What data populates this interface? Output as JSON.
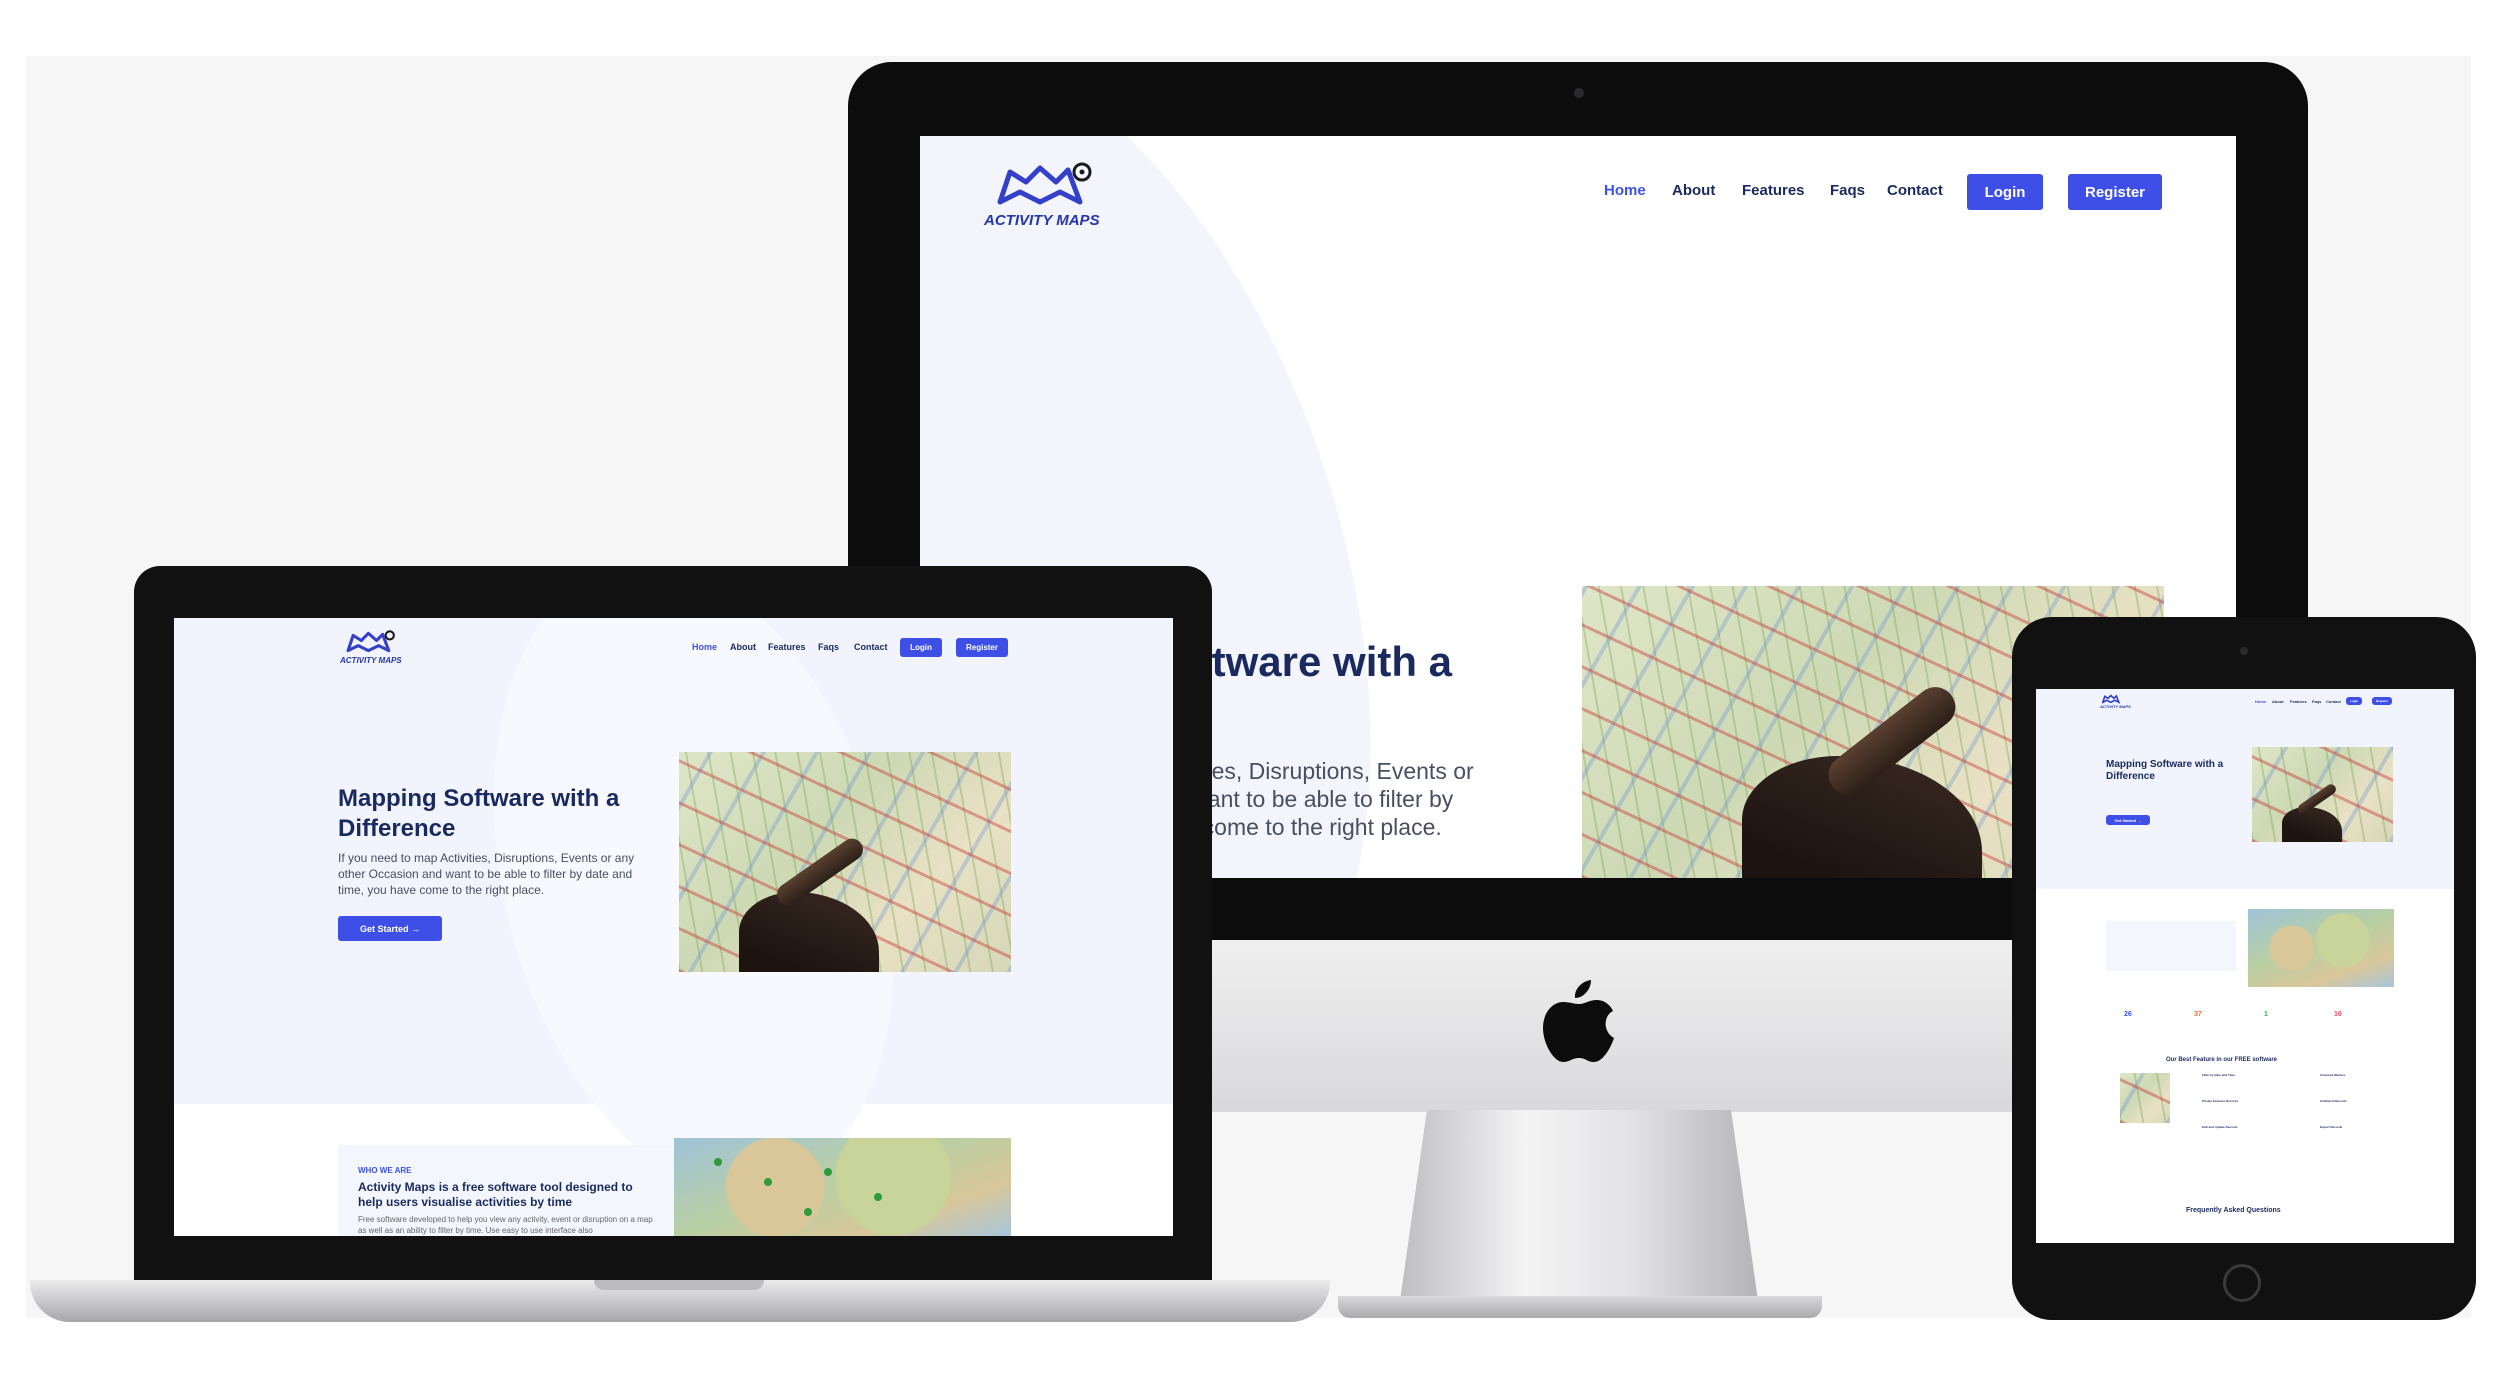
{
  "site": {
    "logo_text": "ACTIVITY MAPS",
    "nav": {
      "home": "Home",
      "about": "About",
      "features": "Features",
      "faqs": "Faqs",
      "contact": "Contact",
      "login": "Login",
      "register": "Register"
    },
    "colors": {
      "accent": "#3d4fe6",
      "navy": "#1b2a5e",
      "active": "#3d52e8"
    }
  },
  "imac": {
    "hero_title_partial": "oftware with a",
    "hero_lines": [
      "tivities, Disruptions, Events or",
      "d want to be able to filter by",
      "ve come to the right place."
    ]
  },
  "laptop": {
    "hero_title": "Mapping Software with a Difference",
    "hero_text": "If you need to map Activities, Disruptions, Events or any other Occasion and want to be able to filter by date and time, you have come to the right place.",
    "cta": "Get Started →",
    "about_eyebrow": "WHO WE ARE",
    "about_title": "Activity Maps is a free software tool designed to help users visualise activities by time",
    "about_text": "Free software developed to help you view any activity, event or disruption on a map as well as an ability to filter by time. Use easy to use interface also"
  },
  "tablet": {
    "hero_title": "Mapping Software with a Difference",
    "cta": "Get Started →",
    "stats": [
      "26",
      "37",
      "1",
      "16"
    ],
    "features_title": "Our Best Feature in our FREE software",
    "feature_items": [
      "Filter by Date and Time",
      "Coloured Markers",
      "Private Features Records",
      "Unlimited Records",
      "Edit and Update Records",
      "Export Records"
    ],
    "faq_title": "Frequently Asked Questions"
  },
  "icons": [
    "map-pin-icon",
    "apple-logo-icon",
    "arrow-right-icon"
  ]
}
